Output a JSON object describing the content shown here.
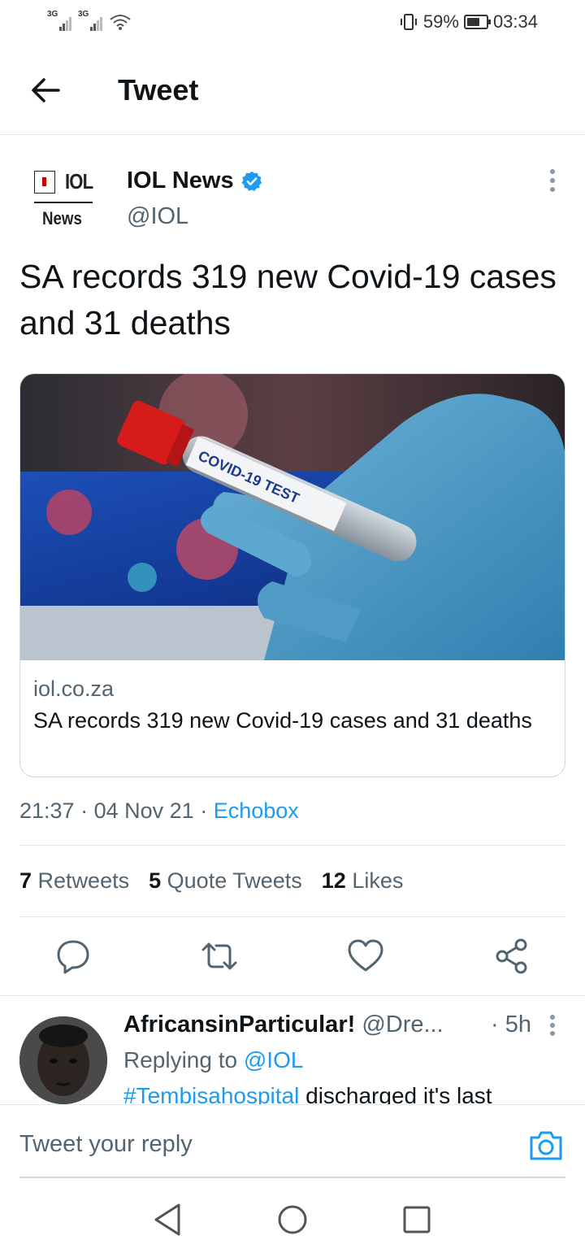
{
  "status_bar": {
    "sim1": "3G",
    "sim2": "3G",
    "battery": "59%",
    "time": "03:34"
  },
  "header": {
    "title": "Tweet"
  },
  "tweet": {
    "avatar_logo_top": "IOL",
    "avatar_logo_bottom": "News",
    "display_name": "IOL News",
    "handle": "@IOL",
    "text": "SA records 319 new Covid-19 cases and 31 deaths",
    "card": {
      "image_label": "COVID-19 TEST",
      "domain": "iol.co.za",
      "title": "SA records 319 new Covid-19 cases and 31 deaths"
    },
    "time": "21:37",
    "date": "04 Nov 21",
    "source": "Echobox",
    "stats": {
      "retweets_count": "7",
      "retweets_label": "Retweets",
      "quotes_count": "5",
      "quotes_label": "Quote Tweets",
      "likes_count": "12",
      "likes_label": "Likes"
    }
  },
  "reply": {
    "name": "AfricansinParticular!",
    "handle": "@Dre...",
    "time": "· 5h",
    "replying_prefix": "Replying to",
    "replying_to": "@IOL",
    "hashtag": "#Tembisahospital",
    "text": " discharged it's last"
  },
  "compose": {
    "placeholder": "Tweet your reply"
  },
  "colors": {
    "accent": "#1d9bf0",
    "text_primary": "#0f1419",
    "text_secondary": "#536471",
    "divider": "#e6e9eb"
  },
  "icons": {
    "back": "arrow-left-icon",
    "verified": "verified-badge-icon",
    "more": "more-vertical-icon",
    "reply": "reply-icon",
    "retweet": "retweet-icon",
    "like": "heart-icon",
    "share": "share-icon",
    "camera": "camera-icon"
  }
}
